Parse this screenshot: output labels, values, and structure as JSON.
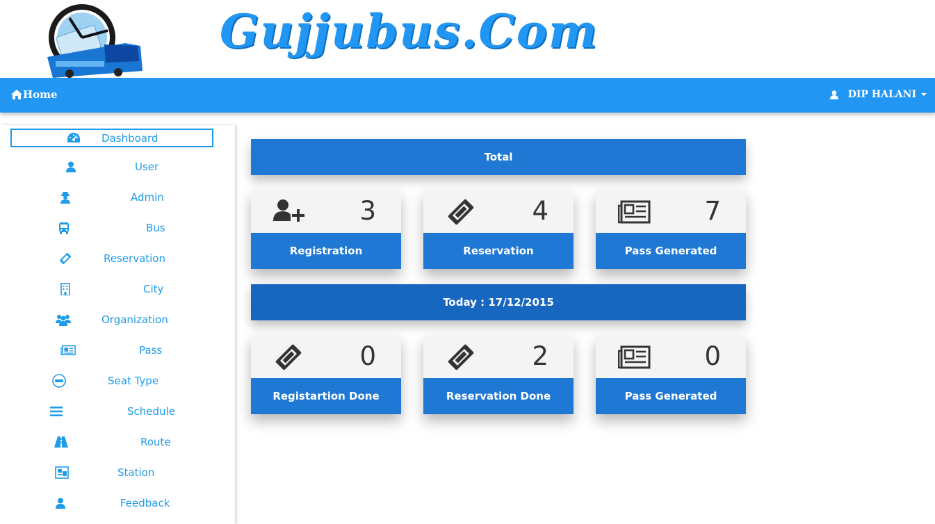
{
  "brand": {
    "name": "Gujjubus.Com"
  },
  "navbar": {
    "home_label": "Home",
    "user_name": "DIP HALANI",
    "accent_color": "#2196f3"
  },
  "sidebar": {
    "items": [
      {
        "label": "Dashboard",
        "icon": "dashboard-icon",
        "active": true
      },
      {
        "label": "User",
        "icon": "user-icon"
      },
      {
        "label": "Admin",
        "icon": "admin-icon"
      },
      {
        "label": "Bus",
        "icon": "bus-icon"
      },
      {
        "label": "Reservation",
        "icon": "ticket-icon"
      },
      {
        "label": "City",
        "icon": "building-icon"
      },
      {
        "label": "Organization",
        "icon": "group-icon"
      },
      {
        "label": "Pass",
        "icon": "newspaper-icon"
      },
      {
        "label": "Seat Type",
        "icon": "minus-circle-icon"
      },
      {
        "label": "Schedule",
        "icon": "list-icon"
      },
      {
        "label": "Route",
        "icon": "road-icon"
      },
      {
        "label": "Station",
        "icon": "station-icon"
      },
      {
        "label": "Feedback",
        "icon": "user-icon"
      }
    ]
  },
  "dashboard": {
    "total_header": "Total",
    "today_header": "Today : 17/12/2015",
    "total_cards": [
      {
        "label": "Registration",
        "value": "3",
        "icon": "user-plus-icon"
      },
      {
        "label": "Reservation",
        "value": "4",
        "icon": "ticket-icon"
      },
      {
        "label": "Pass Generated",
        "value": "7",
        "icon": "newspaper-icon"
      }
    ],
    "today_cards": [
      {
        "label": "Registartion Done",
        "value": "0",
        "icon": "ticket-icon"
      },
      {
        "label": "Reservation Done",
        "value": "2",
        "icon": "ticket-icon"
      },
      {
        "label": "Pass Generated",
        "value": "0",
        "icon": "newspaper-icon"
      }
    ]
  }
}
